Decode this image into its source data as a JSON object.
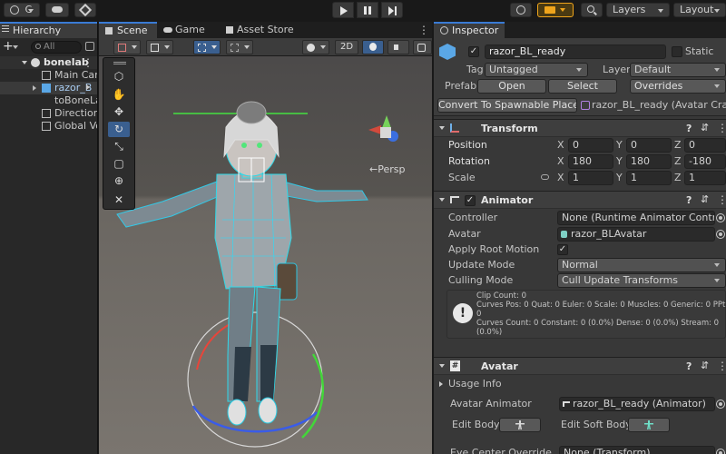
{
  "colors": {
    "accent": "#3a7bd5",
    "selection": "#3a5f8f",
    "play_highlight": "#f0a51c",
    "panel_bg": "#383838"
  },
  "toolbar": {
    "account_label": "C",
    "cloud_icon": "cloud-icon",
    "collab_icon": "collab-icon",
    "history_icon": "history-icon",
    "search_icon": "search-icon",
    "layers_label": "Layers",
    "layout_label": "Layout"
  },
  "hierarchy": {
    "tab_label": "Hierarchy",
    "search_placeholder": "All",
    "scene_name": "bonelab",
    "items": [
      {
        "label": "Main Cam"
      },
      {
        "label": "razor_B"
      },
      {
        "label": "toBoneLa"
      },
      {
        "label": "Directiona"
      },
      {
        "label": "Global Vo"
      }
    ]
  },
  "scene": {
    "tabs": [
      {
        "label": "Scene"
      },
      {
        "label": "Game"
      },
      {
        "label": "Asset Store"
      }
    ],
    "mode_2d_label": "2D",
    "persp_label": "←Persp"
  },
  "inspector": {
    "tab_label": "Inspector",
    "object_name": "razor_BL_ready",
    "static_label": "Static",
    "tag_label": "Tag",
    "tag_value": "Untagged",
    "layer_label": "Layer",
    "layer_value": "Default",
    "prefab_label": "Prefab",
    "open_label": "Open",
    "select_label": "Select",
    "overrides_label": "Overrides",
    "convert_label": "Convert To Spawnable Placer",
    "convert_target": "razor_BL_ready (Avatar Cra",
    "transform": {
      "title": "Transform",
      "position_label": "Position",
      "rotation_label": "Rotation",
      "scale_label": "Scale",
      "position": {
        "x": "0",
        "y": "0",
        "z": "0"
      },
      "rotation": {
        "x": "180",
        "y": "180",
        "z": "-180"
      },
      "scale": {
        "x": "1",
        "y": "1",
        "z": "1"
      }
    },
    "animator": {
      "title": "Animator",
      "controller_label": "Controller",
      "controller_value": "None (Runtime Animator Controller)",
      "avatar_label": "Avatar",
      "avatar_value": "razor_BLAvatar",
      "apply_root_label": "Apply Root Motion",
      "update_mode_label": "Update Mode",
      "update_mode_value": "Normal",
      "culling_mode_label": "Culling Mode",
      "culling_mode_value": "Cull Update Transforms",
      "info_lines": [
        "Clip Count: 0",
        "Curves Pos: 0 Quat: 0 Euler: 0 Scale: 0 Muscles: 0 Generic: 0 PPtr:",
        "0",
        "Curves Count: 0 Constant: 0 (0.0%) Dense: 0 (0.0%) Stream: 0",
        "(0.0%)"
      ]
    },
    "avatar": {
      "title": "Avatar",
      "usage_info_label": "Usage Info",
      "avatar_animator_label": "Avatar Animator",
      "avatar_animator_value": "razor_BL_ready (Animator)",
      "edit_body_label": "Edit Body",
      "edit_soft_body_label": "Edit Soft Body",
      "eye_override_label": "Eye Center Override",
      "eye_override_value": "None (Transform)"
    }
  }
}
